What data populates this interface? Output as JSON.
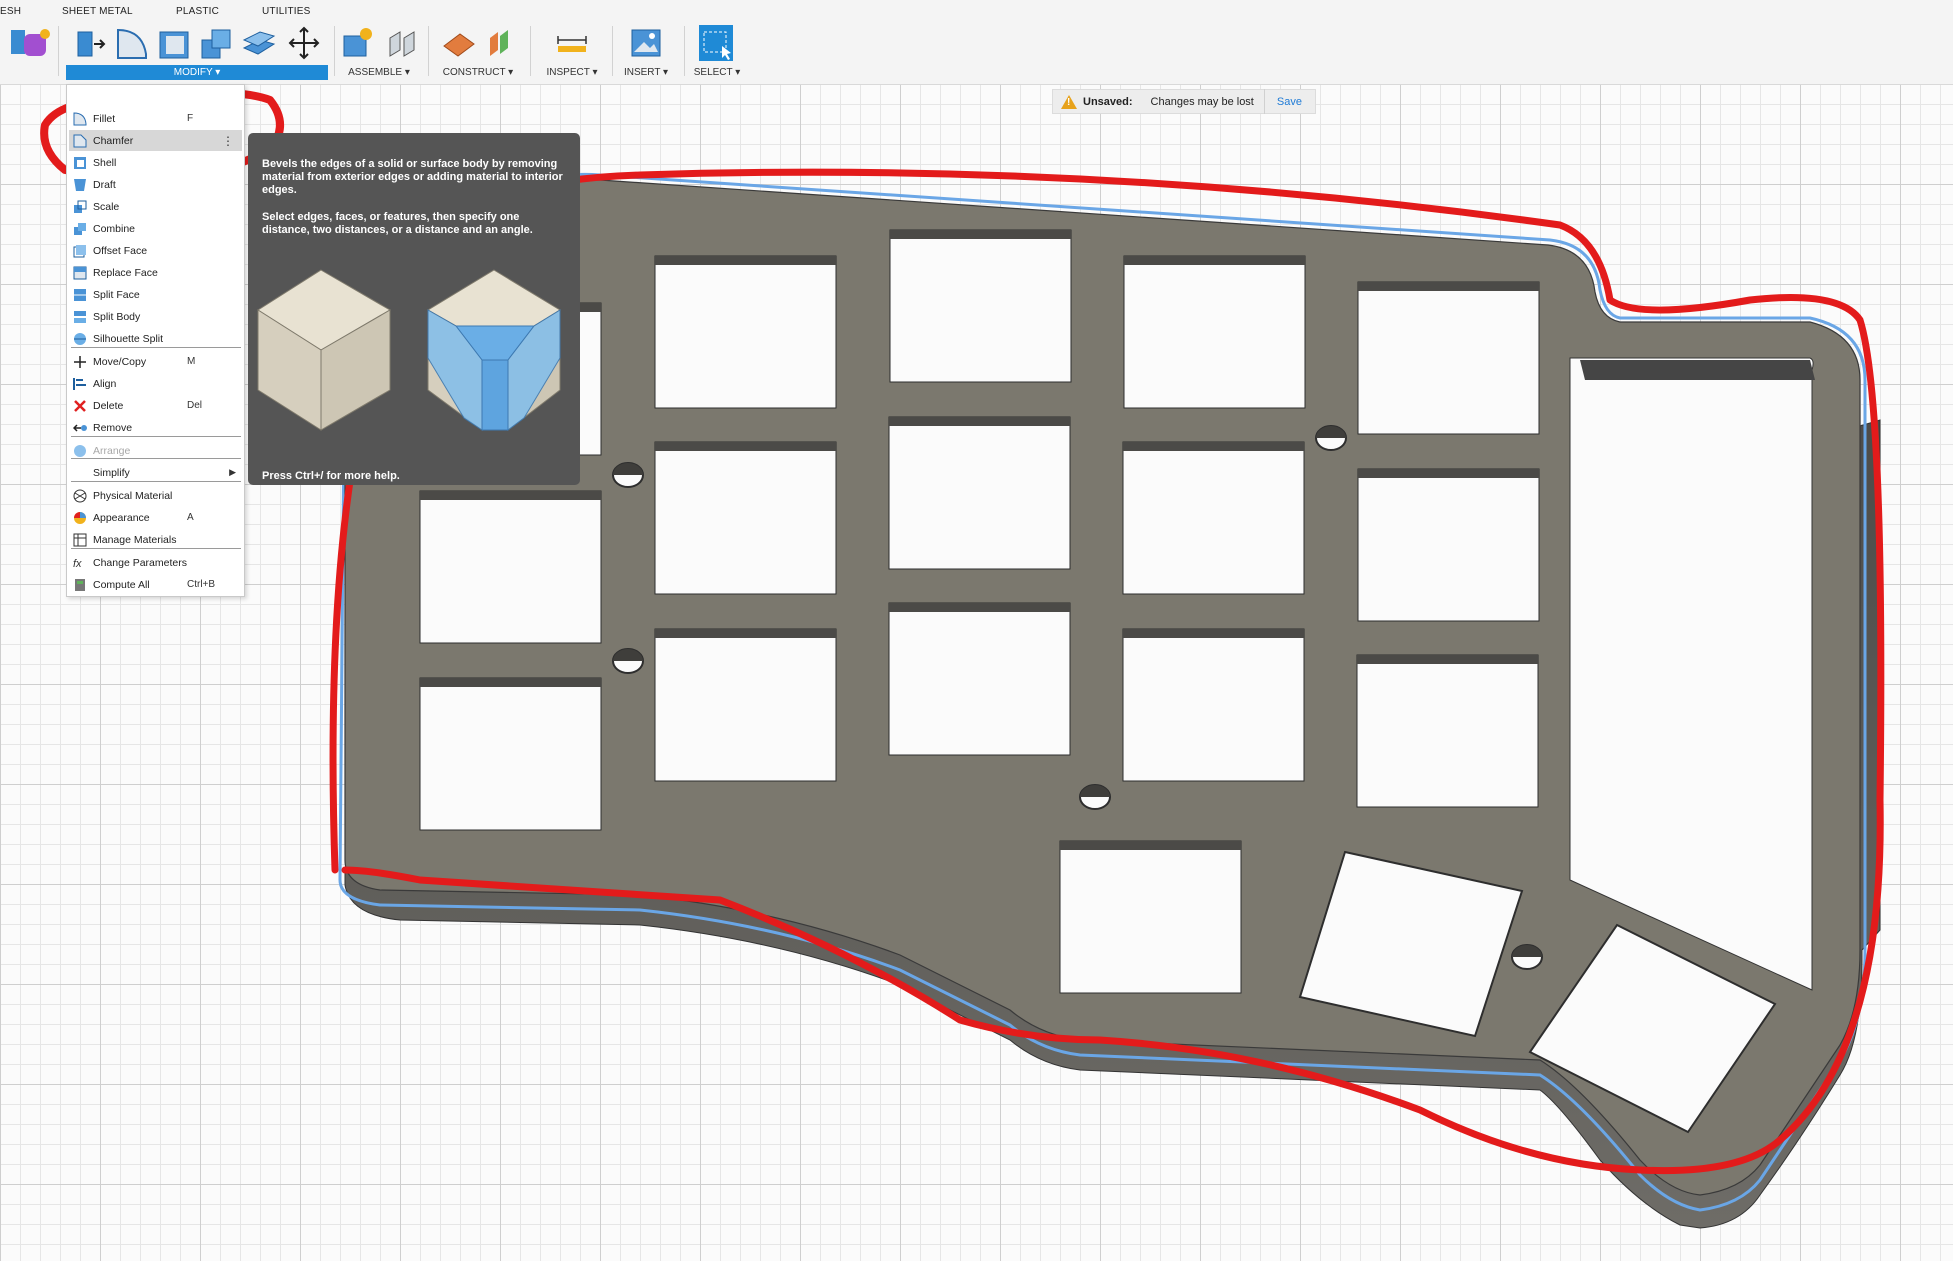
{
  "workspace_tabs": [
    "ESH",
    "SHEET METAL",
    "PLASTIC",
    "UTILITIES"
  ],
  "toolbar": {
    "groups": {
      "modify": "MODIFY ▾",
      "assemble": "ASSEMBLE ▾",
      "construct": "CONSTRUCT ▾",
      "inspect": "INSPECT ▾",
      "insert": "INSERT ▾",
      "select": "SELECT ▾"
    }
  },
  "banner": {
    "status": "Unsaved:",
    "message": "Changes may be lost",
    "save": "Save",
    "warning_color": "#e7a21b",
    "link_color": "#1f7bd6"
  },
  "modify_menu": {
    "items": [
      {
        "label": "Fillet",
        "shortcut": "F",
        "icon": "fillet-icon"
      },
      {
        "label": "Chamfer",
        "shortcut": "",
        "icon": "chamfer-icon",
        "highlighted": true
      },
      {
        "label": "Shell",
        "shortcut": "",
        "icon": "shell-icon"
      },
      {
        "label": "Draft",
        "shortcut": "",
        "icon": "draft-icon"
      },
      {
        "label": "Scale",
        "shortcut": "",
        "icon": "scale-icon"
      },
      {
        "label": "Combine",
        "shortcut": "",
        "icon": "combine-icon"
      },
      {
        "label": "Offset Face",
        "shortcut": "",
        "icon": "offset-face-icon"
      },
      {
        "label": "Replace Face",
        "shortcut": "",
        "icon": "replace-face-icon"
      },
      {
        "label": "Split Face",
        "shortcut": "",
        "icon": "split-face-icon"
      },
      {
        "label": "Split Body",
        "shortcut": "",
        "icon": "split-body-icon"
      },
      {
        "label": "Silhouette Split",
        "shortcut": "",
        "icon": "silhouette-split-icon"
      },
      {
        "label": "Move/Copy",
        "shortcut": "M",
        "icon": "move-icon"
      },
      {
        "label": "Align",
        "shortcut": "",
        "icon": "align-icon"
      },
      {
        "label": "Delete",
        "shortcut": "Del",
        "icon": "delete-icon"
      },
      {
        "label": "Remove",
        "shortcut": "",
        "icon": "remove-icon"
      },
      {
        "label": "Arrange",
        "shortcut": "",
        "icon": "arrange-icon",
        "disabled": true
      },
      {
        "label": "Simplify",
        "shortcut": "",
        "icon": "",
        "submenu": true
      },
      {
        "label": "Physical Material",
        "shortcut": "",
        "icon": "physical-material-icon"
      },
      {
        "label": "Appearance",
        "shortcut": "A",
        "icon": "appearance-icon"
      },
      {
        "label": "Manage Materials",
        "shortcut": "",
        "icon": "manage-materials-icon"
      },
      {
        "label": "Change Parameters",
        "shortcut": "",
        "icon": "fx-icon"
      },
      {
        "label": "Compute All",
        "shortcut": "Ctrl+B",
        "icon": "compute-all-icon"
      }
    ]
  },
  "tooltip": {
    "para1": "Bevels the edges of a solid or surface body by removing material from exterior edges or adding material to interior edges.",
    "para2": "Select edges, faces, or features, then specify one distance, two distances, or a distance and an angle.",
    "footer": "Press Ctrl+/ for more help."
  },
  "colors": {
    "accent": "#1f8ad6",
    "plate_top": "#7b786e",
    "plate_side": "#5b5a56",
    "annotation_red": "#e31b1b"
  }
}
